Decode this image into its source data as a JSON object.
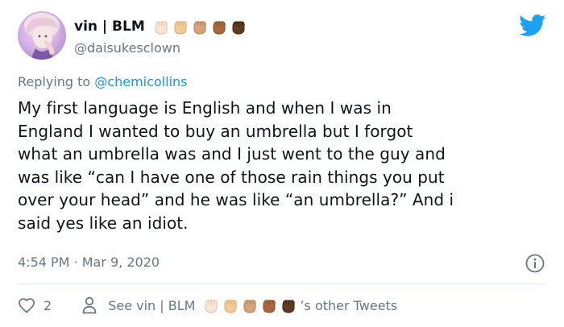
{
  "author": {
    "name": "vin | BLM",
    "handle": "@daisukesclown",
    "avatar_icon": "anime-character-avatar",
    "emoji_fists": [
      "raised-fist-light",
      "raised-fist-medium-light",
      "raised-fist-medium",
      "raised-fist-medium-dark",
      "raised-fist-dark"
    ]
  },
  "reply": {
    "prefix": "Replying to",
    "mention": "@chemicollins"
  },
  "tweet": {
    "lines": [
      "My first language is English and when I was in",
      "England I wanted to buy an umbrella but I forgot",
      "what an umbrella was and I just went to the guy and",
      "was like “can I have one of those rain things you put",
      "over your head” and he was like “an umbrella?” And i",
      "said yes like an idiot."
    ]
  },
  "timestamp": "4:54 PM · Mar 9, 2020",
  "actions": {
    "likes": "2",
    "see_prefix": "See vin | BLM",
    "see_suffix": "’s other Tweets"
  },
  "colors": {
    "brand": "#1da1f2",
    "muted": "#657786",
    "link": "#1b95e0",
    "divider": "#e1e8ed"
  },
  "icons": {
    "logo": "twitter-bird-icon",
    "info": "info-icon",
    "like": "heart-icon",
    "profile": "person-icon"
  }
}
